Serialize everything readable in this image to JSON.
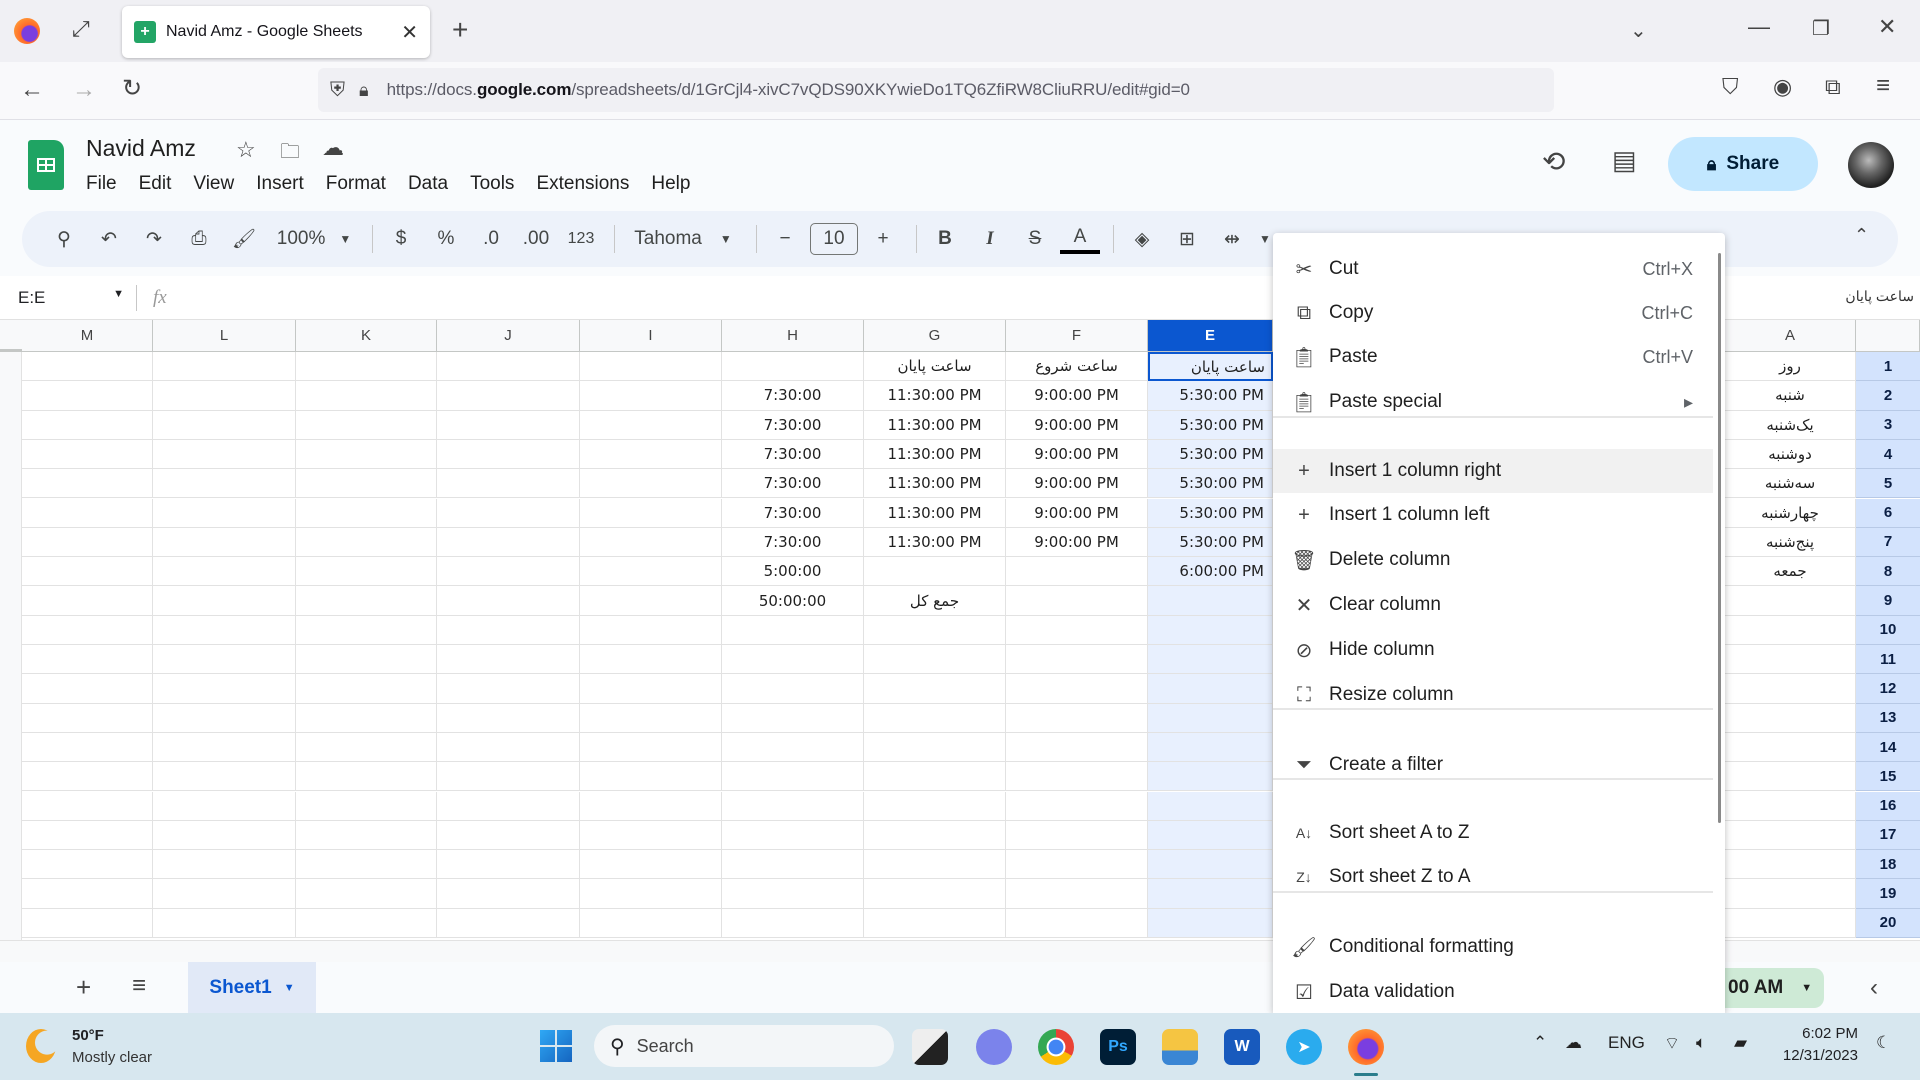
{
  "browser": {
    "tab_title": "Navid Amz - Google Sheets",
    "url_prefix": "https://docs.",
    "url_domain": "google.com",
    "url_suffix": "/spreadsheets/d/1GrCjl4-xivC7vQDS90XKYwieDo1TQ6ZfiRW8CliuRRU/edit#gid=0"
  },
  "app": {
    "doc_title": "Navid Amz",
    "menu": [
      "File",
      "Edit",
      "View",
      "Insert",
      "Format",
      "Data",
      "Tools",
      "Extensions",
      "Help"
    ],
    "share_label": "Share"
  },
  "toolbar": {
    "zoom": "100%",
    "currency": "$",
    "percent": "%",
    "dec_decrease": ".0",
    "dec_increase": ".00",
    "number_format": "123",
    "font": "Tahoma",
    "font_size": "10",
    "bold": "B",
    "italic": "I",
    "text_color": "A"
  },
  "formula_bar": {
    "name_box": "E:E",
    "fx": "fx",
    "value": "ساعت پایان"
  },
  "grid": {
    "columns": [
      "M",
      "L",
      "K",
      "J",
      "I",
      "H",
      "G",
      "F",
      "E",
      "A"
    ],
    "selected_column": "E",
    "row_numbers": [
      "1",
      "2",
      "3",
      "4",
      "5",
      "6",
      "7",
      "8",
      "9",
      "10",
      "11",
      "12",
      "13",
      "14",
      "15",
      "16",
      "17",
      "18",
      "19",
      "20"
    ],
    "col_H": [
      "",
      "7:30:00",
      "7:30:00",
      "7:30:00",
      "7:30:00",
      "7:30:00",
      "7:30:00",
      "5:00:00",
      "50:00:00"
    ],
    "col_G": [
      "ساعت پایان",
      "11:30:00 PM",
      "11:30:00 PM",
      "11:30:00 PM",
      "11:30:00 PM",
      "11:30:00 PM",
      "11:30:00 PM",
      "",
      "جمع کل"
    ],
    "col_F": [
      "ساعت شروع",
      "9:00:00 PM",
      "9:00:00 PM",
      "9:00:00 PM",
      "9:00:00 PM",
      "9:00:00 PM",
      "9:00:00 PM",
      "",
      ""
    ],
    "col_E": [
      "ساعت پایان",
      "5:30:00 PM",
      "5:30:00 PM",
      "5:30:00 PM",
      "5:30:00 PM",
      "5:30:00 PM",
      "5:30:00 PM",
      "6:00:00 PM",
      ""
    ],
    "col_A": [
      "روز",
      "شنبه",
      "یک‌شنبه",
      "دوشنبه",
      "سه‌شنبه",
      "چهارشنبه",
      "پنج‌شنبه",
      "جمعه",
      ""
    ]
  },
  "context_menu": {
    "items": [
      {
        "label": "Cut",
        "shortcut": "Ctrl+X",
        "icon": "scissors-icon"
      },
      {
        "label": "Copy",
        "shortcut": "Ctrl+C",
        "icon": "copy-icon"
      },
      {
        "label": "Paste",
        "shortcut": "Ctrl+V",
        "icon": "clipboard-icon"
      },
      {
        "label": "Paste special",
        "shortcut": "",
        "icon": "clipboard-icon",
        "submenu": true
      },
      {
        "label": "Insert 1 column right",
        "shortcut": "",
        "icon": "plus-icon",
        "highlighted": true
      },
      {
        "label": "Insert 1 column left",
        "shortcut": "",
        "icon": "plus-icon"
      },
      {
        "label": "Delete column",
        "shortcut": "",
        "icon": "trash-icon"
      },
      {
        "label": "Clear column",
        "shortcut": "",
        "icon": "x-icon"
      },
      {
        "label": "Hide column",
        "shortcut": "",
        "icon": "eye-off-icon"
      },
      {
        "label": "Resize column",
        "shortcut": "",
        "icon": "resize-icon"
      },
      {
        "label": "Create a filter",
        "shortcut": "",
        "icon": "filter-icon"
      },
      {
        "label": "Sort sheet A to Z",
        "shortcut": "",
        "icon": "sort-az-icon"
      },
      {
        "label": "Sort sheet Z to A",
        "shortcut": "",
        "icon": "sort-za-icon"
      },
      {
        "label": "Conditional formatting",
        "shortcut": "",
        "icon": "paint-roller-icon"
      },
      {
        "label": "Data validation",
        "shortcut": "",
        "icon": "data-validation-icon"
      }
    ]
  },
  "bottom_bar": {
    "sheet_tab": "Sheet1",
    "summary_chip": "00 AM"
  },
  "taskbar": {
    "weather_temp": "50°F",
    "weather_desc": "Mostly clear",
    "search_placeholder": "Search",
    "lang": "ENG",
    "time": "6:02 PM",
    "date": "12/31/2023"
  },
  "colors": {
    "accent": "#0b57d0",
    "share_bg": "#c2e7ff",
    "selected_col_bg": "#e8f0fe",
    "row_header_bg": "#d3e3fd",
    "chip_bg": "#ceead6"
  }
}
